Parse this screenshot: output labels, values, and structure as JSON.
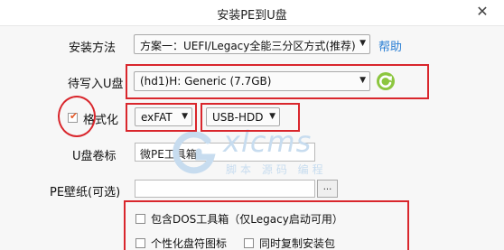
{
  "window": {
    "title": "安装PE到U盘",
    "close_icon": "✕"
  },
  "install_method": {
    "label": "安装方法",
    "selected": "方案一：UEFI/Legacy全能三分区方式(推荐)",
    "help_link": "帮助"
  },
  "target_disk": {
    "label": "待写入U盘",
    "selected": "(hd1)H: Generic  (7.7GB)",
    "refresh_icon": "refresh-icon"
  },
  "format": {
    "checkbox_label": "格式化",
    "checked": true,
    "fs_selected": "exFAT",
    "mode_selected": "USB-HDD"
  },
  "volume_label": {
    "label": "U盘卷标",
    "value": "微PE工具箱"
  },
  "wallpaper": {
    "label": "PE壁纸(可选)",
    "value": "",
    "browse_label": "..."
  },
  "options": {
    "include_dos": "包含DOS工具箱（仅Legacy启动可用）",
    "custom_icon": "个性化盘符图标",
    "copy_installer": "同时复制安装包"
  },
  "watermark": {
    "brand": "xlcms",
    "sub": "脚本 源码 编程"
  },
  "colors": {
    "annotation_red": "#d9262c",
    "link_blue": "#2a7fd4",
    "check_orange": "#e55b2a",
    "refresh_green": "#5aa52a"
  }
}
